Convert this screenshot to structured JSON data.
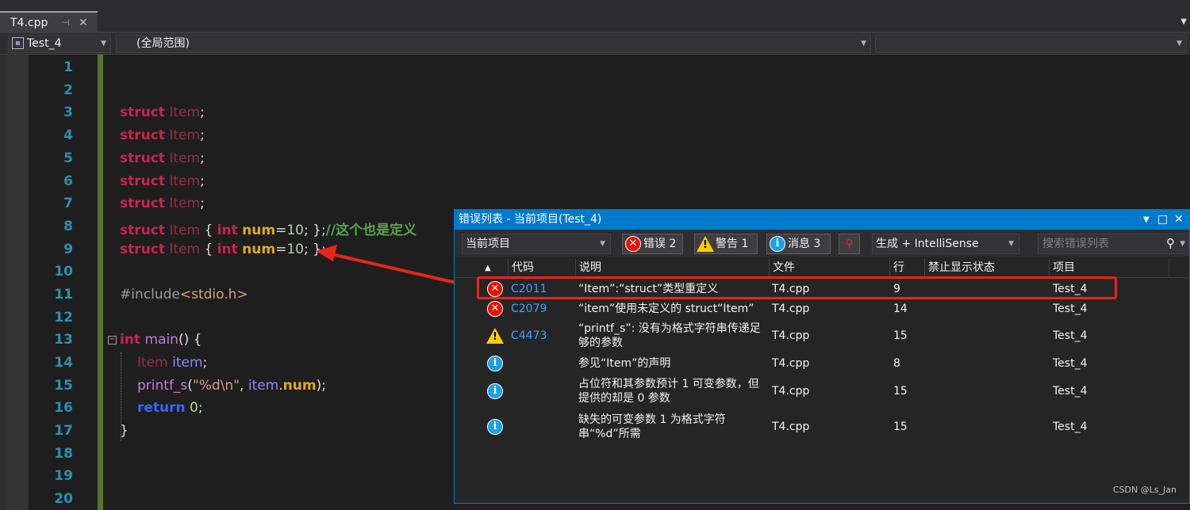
{
  "tab": {
    "title": "T4.cpp",
    "pin_glyph": "⊣",
    "close_glyph": "✕"
  },
  "navbar": {
    "project": "Test_4",
    "scope": "(全局范围)"
  },
  "editor": {
    "line_numbers": [
      "1",
      "2",
      "3",
      "4",
      "5",
      "6",
      "7",
      "8",
      "9",
      "10",
      "11",
      "12",
      "13",
      "14",
      "15",
      "16",
      "17",
      "18",
      "19",
      "20"
    ]
  },
  "code": {
    "struct_kw": "struct",
    "item_type": "Item",
    "semicolon": ";",
    "int_kw": "int",
    "num_field": "num",
    "eq": "=",
    "ten": "10",
    "brace_open": "{",
    "brace_close": "}",
    "comment": "//这个也是定义",
    "include_pp": "#include",
    "include_file": "<stdio.h>",
    "main_fn": "main",
    "paren": "()",
    "item_var": "item",
    "printf_fn": "printf_s",
    "format_str": "\"%d\\n\"",
    "comma": ",",
    "dot": ".",
    "return_kw": "return",
    "zero": "0",
    "open_paren": "(",
    "close_paren_semi": ");"
  },
  "error_list": {
    "title": "错误列表 - 当前项目(Test_4)",
    "scope_select": "当前项目",
    "errors_btn": "错误 2",
    "warnings_btn": "警告 1",
    "messages_btn": "消息 3",
    "build_select": "生成 + IntelliSense",
    "search_placeholder": "搜索错误列表",
    "columns": {
      "code": "代码",
      "description": "说明",
      "file": "文件",
      "line": "行",
      "suppression": "禁止显示状态",
      "project": "项目"
    },
    "rows": [
      {
        "severity": "error",
        "code": "C2011",
        "description": "“Item”:“struct”类型重定义",
        "file": "T4.cpp",
        "line": "9",
        "project": "Test_4"
      },
      {
        "severity": "error",
        "code": "C2079",
        "description": "“item”使用未定义的 struct“Item”",
        "file": "T4.cpp",
        "line": "14",
        "project": "Test_4"
      },
      {
        "severity": "warning",
        "code": "C4473",
        "description": "“printf_s”: 没有为格式字符串传递足够的参数",
        "file": "T4.cpp",
        "line": "15",
        "project": "Test_4"
      },
      {
        "severity": "info",
        "code": "",
        "description": "参见“Item”的声明",
        "file": "T4.cpp",
        "line": "8",
        "project": "Test_4"
      },
      {
        "severity": "info",
        "code": "",
        "description": "占位符和其参数预计 1 可变参数，但提供的却是 0 参数",
        "file": "T4.cpp",
        "line": "15",
        "project": "Test_4"
      },
      {
        "severity": "info",
        "code": "",
        "description": "缺失的可变参数 1 为格式字符串“%d”所需",
        "file": "T4.cpp",
        "line": "15",
        "project": "Test_4"
      }
    ]
  },
  "watermark": "CSDN @Ls_Jan",
  "colors": {
    "accent": "#007acc",
    "error": "#e51400",
    "warning": "#ffcc00",
    "info": "#1ba1e2",
    "highlight": "#e8241b"
  }
}
